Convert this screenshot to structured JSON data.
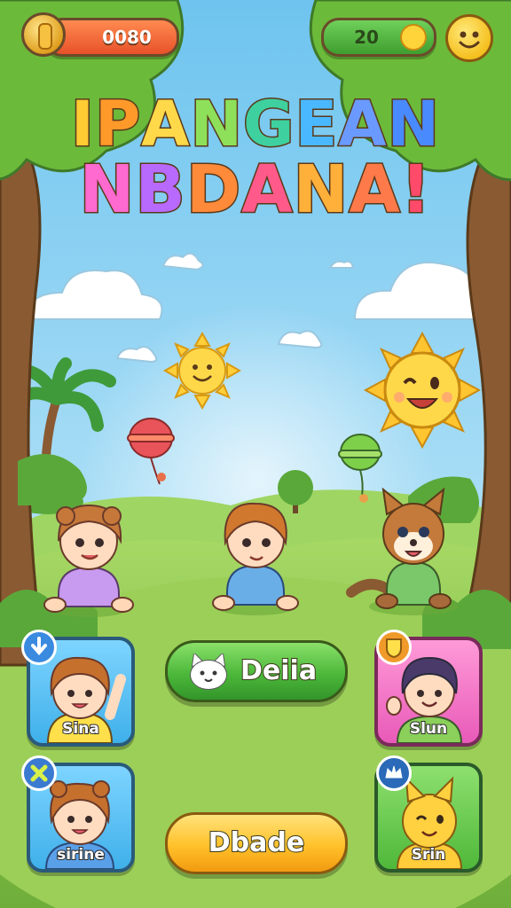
{
  "hud": {
    "coins": "0080",
    "score": "20"
  },
  "title": {
    "line1": [
      "I",
      "P",
      "A",
      "N",
      "G",
      "E",
      "A",
      "N"
    ],
    "line2": [
      "N",
      "B",
      "D",
      "A",
      "N",
      "A",
      "!"
    ],
    "line1_colors": [
      "#ffcc33",
      "#ff9a2a",
      "#ffd94a",
      "#8ee05a",
      "#3fd0a0",
      "#4ab8ff",
      "#6a9aff",
      "#4a8aff"
    ],
    "line2_colors": [
      "#ff6ad0",
      "#b86aff",
      "#ff8a3a",
      "#ff5a8a",
      "#ffb03a",
      "#ff7a4a",
      "#ff4a6a"
    ]
  },
  "buttons": {
    "green_label": "Deiia",
    "yellow_label": "Dbade"
  },
  "cards": {
    "sina": "Sina",
    "sirine": "sirine",
    "sun": "Slun",
    "srin": "Srin"
  },
  "colors": {
    "sky_top": "#6ec4ef",
    "sky_bottom": "#cfeefa",
    "grass": "#8fcb52",
    "grass_dark": "#6aa838",
    "tree_trunk": "#8a5a32",
    "foliage": "#6cba3a"
  },
  "icons": {
    "coin": "coin-icon",
    "score_sun": "sun-icon",
    "menu_smiley": "smiley-icon",
    "sina_badge": "down-arrow-icon",
    "sirine_badge": "close-icon",
    "sun_badge": "shield-icon",
    "srin_badge": "crown-icon"
  }
}
